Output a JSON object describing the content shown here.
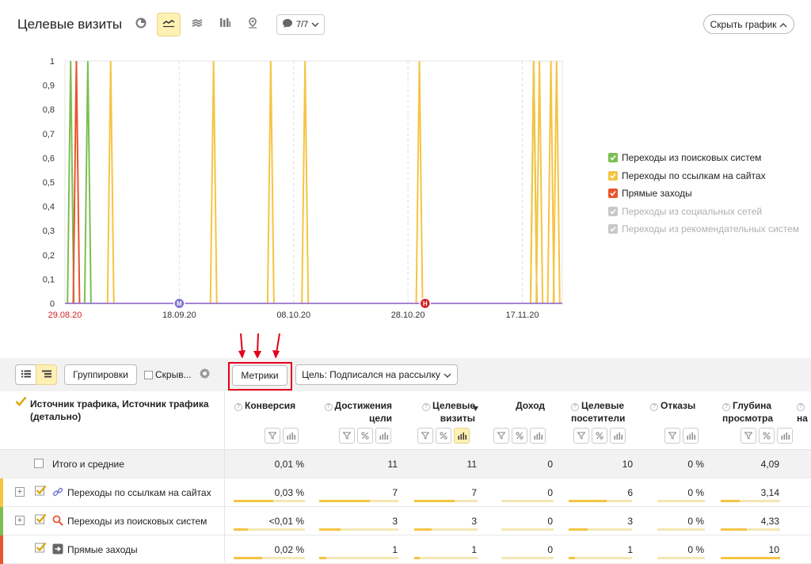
{
  "header": {
    "title": "Целевые визиты",
    "segment_count": "7/7",
    "hide_chart_label": "Скрыть график"
  },
  "chart_data": {
    "type": "line",
    "ylim": [
      0,
      1
    ],
    "yticks": [
      "1",
      "0,9",
      "0,8",
      "0,7",
      "0,6",
      "0,5",
      "0,4",
      "0,3",
      "0,2",
      "0,1",
      "0"
    ],
    "xticks": [
      "29.08.20",
      "18.09.20",
      "08.10.20",
      "28.10.20",
      "17.11.20"
    ],
    "x_first_day": "29.08.20",
    "x_last_day": "24.11.20",
    "series": [
      {
        "name": "Переходы из поисковых систем",
        "color": "#7cbf50",
        "spike_days": [
          "30.08.20",
          "02.09.20",
          "19.11.20"
        ]
      },
      {
        "name": "Переходы по ссылкам на сайтах",
        "color": "#f5c443",
        "spike_days": [
          "06.09.20",
          "24.09.20",
          "04.10.20",
          "10.10.20",
          "30.10.20",
          "19.11.20",
          "20.11.20",
          "22.11.20",
          "23.11.20"
        ]
      },
      {
        "name": "Прямые заходы",
        "color": "#e8552f",
        "spike_days": [
          "31.08.20"
        ]
      }
    ],
    "markers": [
      {
        "label": "M",
        "color": "#7b6dcc",
        "day": "18.09.20"
      },
      {
        "label": "H",
        "color": "#d11f25",
        "day": "31.10.20"
      }
    ]
  },
  "legend": [
    {
      "label": "Переходы из поисковых систем",
      "color": "#7cbf50",
      "enabled": true
    },
    {
      "label": "Переходы по ссылкам на сайтах",
      "color": "#f5c443",
      "enabled": true
    },
    {
      "label": "Прямые заходы",
      "color": "#e8552f",
      "enabled": true
    },
    {
      "label": "Переходы из социальных сетей",
      "color": "#c8c8c8",
      "enabled": false
    },
    {
      "label": "Переходы из рекомендательных систем",
      "color": "#c8c8c8",
      "enabled": false
    }
  ],
  "toolbar": {
    "groupings_label": "Группировки",
    "hide_label": "Скрыв...",
    "metrics_label": "Метрики",
    "goal_label": "Цель: Подписался на рассылку"
  },
  "table": {
    "dimension_header": "Источник трафика, Источник трафика (детально)",
    "columns": [
      {
        "label": "Конверсия"
      },
      {
        "label": "Достижения цели"
      },
      {
        "label": "Целевые визиты"
      },
      {
        "label": "Доход"
      },
      {
        "label": "Целевые посетители"
      },
      {
        "label": "Отказы"
      },
      {
        "label": "Глубина просмотра"
      },
      {
        "label": "на"
      }
    ],
    "totals": {
      "label": "Итого и средние",
      "values": [
        "0,01 %",
        "11",
        "11",
        "0",
        "10",
        "0 %",
        "4,09"
      ]
    },
    "rows": [
      {
        "label": "Переходы по ссылкам на сайтах",
        "stripe": "#f5c443",
        "values": [
          "0,03 %",
          "7",
          "7",
          "0",
          "6",
          "0 %",
          "3,14"
        ],
        "shares": [
          0.55,
          0.64,
          0.64,
          0,
          0.6,
          0,
          0.32
        ]
      },
      {
        "label": "Переходы из поисковых систем",
        "stripe": "#7cbf50",
        "values": [
          "<0,01 %",
          "3",
          "3",
          "0",
          "3",
          "0 %",
          "4,33"
        ],
        "shares": [
          0.2,
          0.27,
          0.27,
          0,
          0.3,
          0,
          0.44
        ]
      },
      {
        "label": "Прямые заходы",
        "stripe": "#e8552f",
        "values": [
          "0,02 %",
          "1",
          "1",
          "0",
          "1",
          "0 %",
          "10"
        ],
        "shares": [
          0.4,
          0.09,
          0.09,
          0,
          0.1,
          0,
          1.0
        ]
      }
    ]
  }
}
